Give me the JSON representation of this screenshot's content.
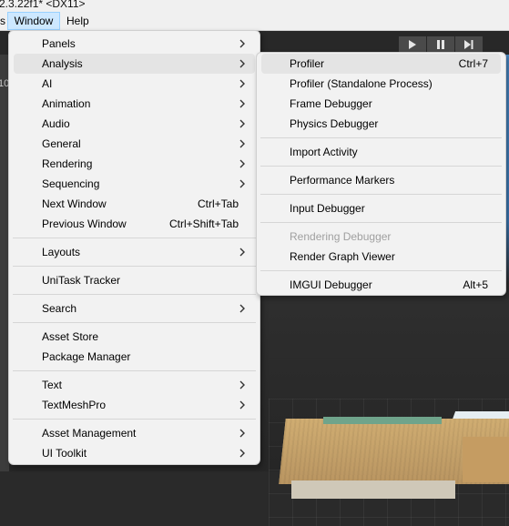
{
  "titlebar": {
    "fragment": "2.3.22f1* <DX11>"
  },
  "menubar": {
    "edge_fragment": "s",
    "window": "Window",
    "help": "Help"
  },
  "left_strip_text": "10",
  "window_menu": {
    "panels": "Panels",
    "analysis": "Analysis",
    "ai": "AI",
    "animation": "Animation",
    "audio": "Audio",
    "general": "General",
    "rendering": "Rendering",
    "sequencing": "Sequencing",
    "next_window": "Next Window",
    "next_window_shortcut": "Ctrl+Tab",
    "previous_window": "Previous Window",
    "previous_window_shortcut": "Ctrl+Shift+Tab",
    "layouts": "Layouts",
    "unitask_tracker": "UniTask Tracker",
    "search": "Search",
    "asset_store": "Asset Store",
    "package_manager": "Package Manager",
    "text": "Text",
    "textmeshpro": "TextMeshPro",
    "asset_management": "Asset Management",
    "ui_toolkit": "UI Toolkit"
  },
  "analysis_menu": {
    "profiler": "Profiler",
    "profiler_shortcut": "Ctrl+7",
    "profiler_standalone": "Profiler (Standalone Process)",
    "frame_debugger": "Frame Debugger",
    "physics_debugger": "Physics Debugger",
    "import_activity": "Import Activity",
    "performance_markers": "Performance Markers",
    "input_debugger": "Input Debugger",
    "rendering_debugger": "Rendering Debugger",
    "render_graph_viewer": "Render Graph Viewer",
    "imgui_debugger": "IMGUI Debugger",
    "imgui_debugger_shortcut": "Alt+5"
  },
  "colors": {
    "menu_bg": "#f2f2f2",
    "highlight": "#e4e4e4",
    "disabled_text": "#a0a0a0",
    "menubar_active": "#cde8ff",
    "toolbar": "#282828"
  },
  "icons": [
    "play-icon",
    "pause-icon",
    "step-icon",
    "chevron-right-icon"
  ]
}
